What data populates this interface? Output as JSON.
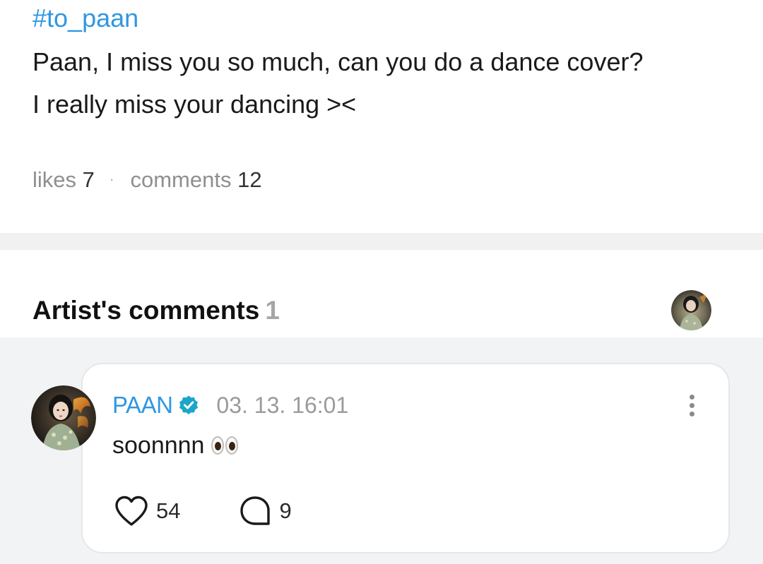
{
  "post": {
    "hashtag": "#to_paan",
    "body_lines": [
      "Paan, I miss you so much, can you do a dance cover?",
      "I really miss your dancing ><"
    ],
    "likes_label": "likes",
    "likes_count": "7",
    "separator": "·",
    "comments_label": "comments",
    "comments_count": "12"
  },
  "artist_comments": {
    "title": "Artist's comments",
    "count": "1"
  },
  "comment": {
    "author": "PAAN",
    "timestamp": "03. 13. 16:01",
    "text": "soonnnn",
    "emoji_icon": "eyes-emoji",
    "like_count": "54",
    "reply_count": "9"
  },
  "colors": {
    "accent": "#2f97e0",
    "verified": "#1ba6c9",
    "band": "#f1f1f2",
    "comment_area_bg": "#f2f3f5"
  }
}
